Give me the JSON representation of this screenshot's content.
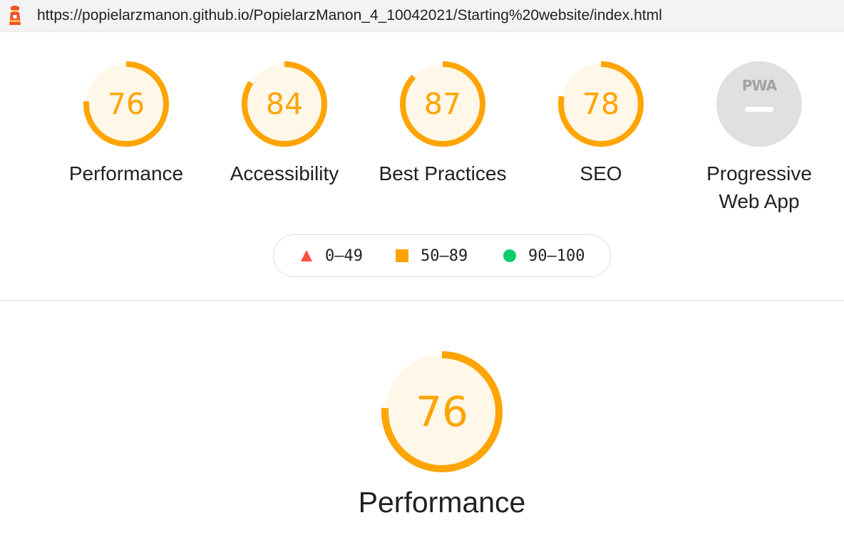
{
  "address_bar": {
    "url": "https://popielarzmanon.github.io/PopielarzManon_4_10042021/Starting%20website/index.html",
    "icon": "lighthouse-icon"
  },
  "gauges": [
    {
      "score": 76,
      "label": "Performance"
    },
    {
      "score": 84,
      "label": "Accessibility"
    },
    {
      "score": 87,
      "label": "Best Practices"
    },
    {
      "score": 78,
      "label": "SEO"
    }
  ],
  "pwa": {
    "badge_text": "PWA",
    "label_line1": "Progressive",
    "label_line2": "Web App"
  },
  "legend": [
    {
      "range": "0–49",
      "shape": "triangle",
      "color": "#ff4e42"
    },
    {
      "range": "50–89",
      "shape": "square",
      "color": "#ffa400"
    },
    {
      "range": "90–100",
      "shape": "circle",
      "color": "#0cce6b"
    }
  ],
  "focused_category": {
    "score": 76,
    "label": "Performance"
  },
  "colors": {
    "average": "#ffa400",
    "average_fill": "#fff7e8",
    "pwa_gray": "#e0e0e0"
  }
}
